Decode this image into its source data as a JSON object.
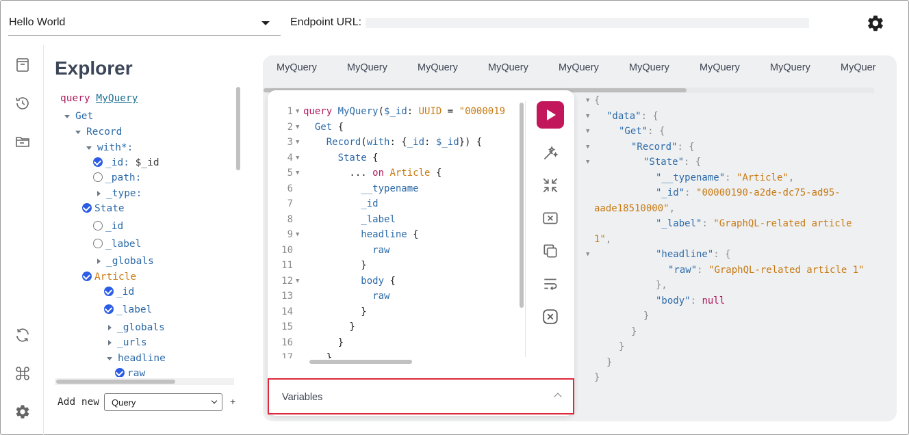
{
  "header": {
    "workspace_select": "Hello World",
    "endpoint_label": "Endpoint URL:",
    "endpoint_value": ""
  },
  "explorer": {
    "title": "Explorer",
    "operation_keyword": "query",
    "operation_name": "MyQuery",
    "tree": [
      {
        "text": "Get",
        "kind": "field",
        "toggle": "open",
        "check": null
      },
      {
        "text": "Record",
        "kind": "field",
        "toggle": "open",
        "check": null
      },
      {
        "text": "with*:",
        "kind": "field",
        "toggle": "open",
        "check": null
      },
      {
        "text": "_id:",
        "arg": "$_id",
        "kind": "field",
        "toggle": null,
        "check": "on"
      },
      {
        "text": "_path:",
        "kind": "field",
        "toggle": null,
        "check": "off"
      },
      {
        "text": "_type:",
        "kind": "field",
        "toggle": "closed",
        "check": null
      },
      {
        "text": "State",
        "kind": "field",
        "toggle": null,
        "check": "on"
      },
      {
        "text": "_id",
        "kind": "field",
        "toggle": null,
        "check": "off"
      },
      {
        "text": "_label",
        "kind": "field",
        "toggle": null,
        "check": "off"
      },
      {
        "text": "_globals",
        "kind": "field",
        "toggle": "closed",
        "check": null
      },
      {
        "text": "Article",
        "kind": "type",
        "toggle": null,
        "check": "on"
      },
      {
        "text": "_id",
        "kind": "field",
        "toggle": null,
        "check": "on"
      },
      {
        "text": "_label",
        "kind": "field",
        "toggle": null,
        "check": "on"
      },
      {
        "text": "_globals",
        "kind": "field",
        "toggle": "closed",
        "check": null
      },
      {
        "text": "_urls",
        "kind": "field",
        "toggle": "closed",
        "check": null
      },
      {
        "text": "headline",
        "kind": "field",
        "toggle": "open",
        "check": null
      },
      {
        "text": "raw",
        "kind": "field",
        "toggle": null,
        "check": "on"
      }
    ],
    "add_new_label": "Add new",
    "add_new_select": "Query",
    "add_new_plus": "+"
  },
  "tabs": [
    "MyQuery",
    "MyQuery",
    "MyQuery",
    "MyQuery",
    "MyQuery",
    "MyQuery",
    "MyQuery",
    "MyQuery",
    "MyQuer"
  ],
  "editor": {
    "lines": [
      {
        "n": "1",
        "fold": "▼",
        "html": "<span class='k'>query</span> <span class='n'>MyQuery</span>(<span class='n'>$_id</span>: <span class='t'>UUID</span> = <span class='s'>\"0000019</span>"
      },
      {
        "n": "2",
        "fold": "▼",
        "html": "  <span class='n'>Get</span> {"
      },
      {
        "n": "3",
        "fold": "▼",
        "html": "    <span class='n'>Record</span>(<span class='n'>with</span>: {<span class='n'>_id</span>: <span class='n'>$_id</span>}) {"
      },
      {
        "n": "4",
        "fold": "▼",
        "html": "      <span class='n'>State</span> {"
      },
      {
        "n": "5",
        "fold": "▼",
        "html": "        ... <span class='k'>on</span> <span class='t'>Article</span> {"
      },
      {
        "n": "6",
        "fold": "",
        "html": "          <span class='n'>__typename</span>"
      },
      {
        "n": "7",
        "fold": "",
        "html": "          <span class='n'>_id</span>"
      },
      {
        "n": "8",
        "fold": "",
        "html": "          <span class='n'>_label</span>"
      },
      {
        "n": "9",
        "fold": "▼",
        "html": "          <span class='n'>headline</span> {"
      },
      {
        "n": "10",
        "fold": "",
        "html": "            <span class='n'>raw</span>"
      },
      {
        "n": "11",
        "fold": "",
        "html": "          }"
      },
      {
        "n": "12",
        "fold": "▼",
        "html": "          <span class='n'>body</span> {"
      },
      {
        "n": "13",
        "fold": "",
        "html": "            <span class='n'>raw</span>"
      },
      {
        "n": "14",
        "fold": "",
        "html": "          }"
      },
      {
        "n": "15",
        "fold": "",
        "html": "        }"
      },
      {
        "n": "16",
        "fold": "",
        "html": "      }"
      },
      {
        "n": "17",
        "fold": "",
        "html": "    }"
      }
    ]
  },
  "variables": {
    "label": "Variables"
  },
  "result": {
    "lines": [
      {
        "fold": "▼",
        "indent": 16,
        "html": "<span class='rp'>{</span>"
      },
      {
        "fold": "▼",
        "indent": 34,
        "html": "<span class='rk'>\"data\"</span><span class='rp'>: {</span>"
      },
      {
        "fold": "▼",
        "indent": 52,
        "html": "<span class='rk'>\"Get\"</span><span class='rp'>: {</span>"
      },
      {
        "fold": "▼",
        "indent": 70,
        "html": "<span class='rk'>\"Record\"</span><span class='rp'>: {</span>"
      },
      {
        "fold": "▼",
        "indent": 88,
        "html": "<span class='rk'>\"State\"</span><span class='rp'>: {</span>"
      },
      {
        "fold": "",
        "indent": 106,
        "html": "<span class='rk'>\"__typename\"</span><span class='rp'>: </span><span class='rs'>\"Article\"</span><span class='rp'>,</span>"
      },
      {
        "fold": "",
        "indent": 106,
        "html": "<span class='rk'>\"_id\"</span><span class='rp'>: </span><span class='rs'>\"00000190-a2de-dc75-ad95-</span>"
      },
      {
        "fold": "",
        "indent": 16,
        "html": "<span class='rs'>aade18510000\"</span><span class='rp'>,</span>"
      },
      {
        "fold": "",
        "indent": 106,
        "html": "<span class='rk'>\"_label\"</span><span class='rp'>: </span><span class='rs'>\"GraphQL-related article</span>"
      },
      {
        "fold": "",
        "indent": 16,
        "html": "<span class='rs'>1\"</span><span class='rp'>,</span>"
      },
      {
        "fold": "▼",
        "indent": 106,
        "html": "<span class='rk'>\"headline\"</span><span class='rp'>: {</span>"
      },
      {
        "fold": "",
        "indent": 124,
        "html": "<span class='rk'>\"raw\"</span><span class='rp'>: </span><span class='rs'>\"GraphQL-related article 1\"</span>"
      },
      {
        "fold": "",
        "indent": 106,
        "html": "<span class='rp'>},</span>"
      },
      {
        "fold": "",
        "indent": 106,
        "html": "<span class='rk'>\"body\"</span><span class='rp'>: </span><span class='rn'>null</span>"
      },
      {
        "fold": "",
        "indent": 88,
        "html": "<span class='rp'>}</span>"
      },
      {
        "fold": "",
        "indent": 70,
        "html": "<span class='rp'>}</span>"
      },
      {
        "fold": "",
        "indent": 52,
        "html": "<span class='rp'>}</span>"
      },
      {
        "fold": "",
        "indent": 34,
        "html": "<span class='rp'>}</span>"
      },
      {
        "fold": "",
        "indent": 16,
        "html": "<span class='rp'>}</span>"
      }
    ]
  }
}
